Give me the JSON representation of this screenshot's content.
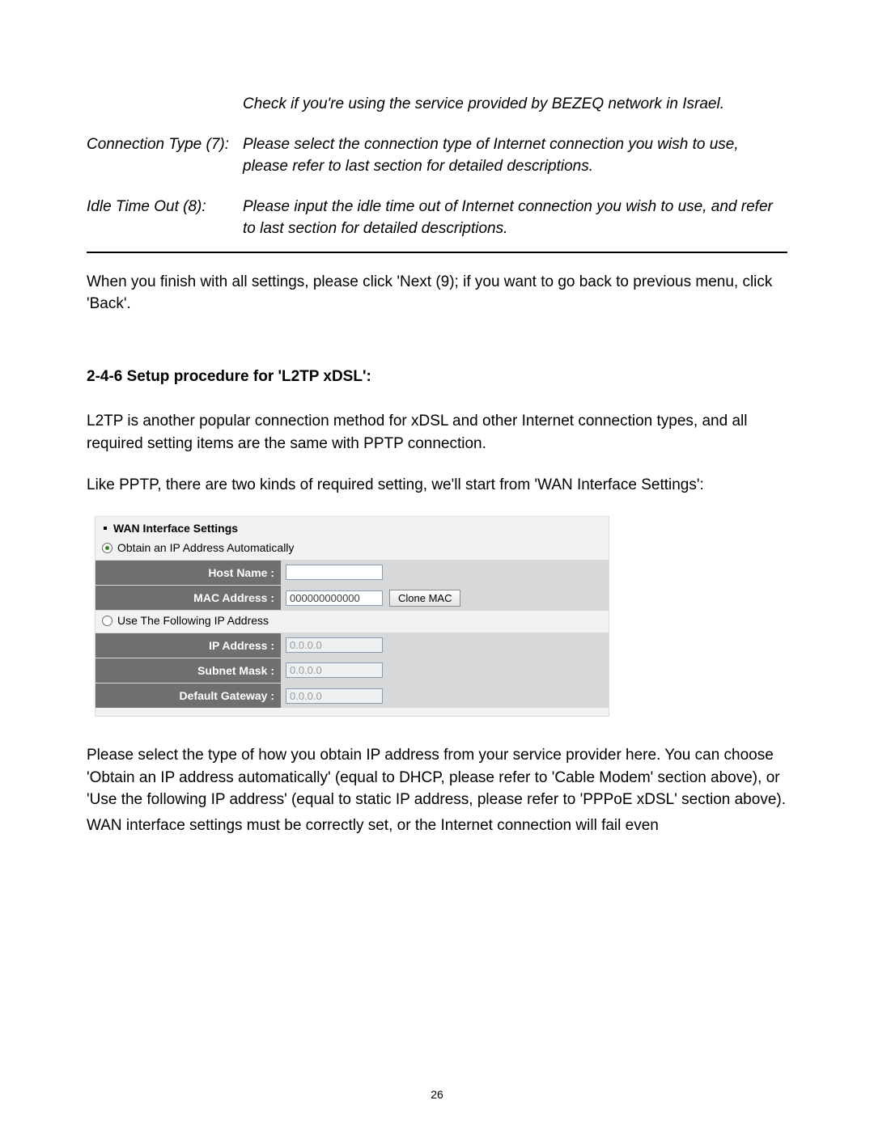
{
  "defs": {
    "bezeq_note": "Check if you're using the service provided by BEZEQ network in Israel.",
    "conn_type_term": "Connection Type (7):",
    "conn_type_desc": "Please select the connection type of Internet connection you wish to use, please refer to last section for detailed descriptions.",
    "idle_term": "Idle Time Out (8):",
    "idle_desc": "Please input the idle time out of Internet connection you wish to use, and refer to last section for detailed descriptions."
  },
  "para_after_defs": "When you finish with all settings, please click 'Next (9); if you want to go back to previous menu, click 'Back'.",
  "section_heading": "2-4-6 Setup procedure for 'L2TP xDSL':",
  "para_l2tp_1": "L2TP is another popular connection method for xDSL and other Internet connection types, and all required setting items are the same with PPTP connection.",
  "para_l2tp_2": "Like PPTP, there are two kinds of required setting, we'll start from 'WAN Interface Settings':",
  "panel": {
    "title": "WAN Interface Settings",
    "radio_auto": "Obtain an IP Address Automatically",
    "radio_static": "Use The Following IP Address",
    "rows": {
      "host_name": {
        "label": "Host Name :",
        "value": ""
      },
      "mac_address": {
        "label": "MAC Address :",
        "value": "000000000000"
      },
      "clone_mac_btn": "Clone MAC",
      "ip_address": {
        "label": "IP Address :",
        "value": "0.0.0.0"
      },
      "subnet_mask": {
        "label": "Subnet Mask :",
        "value": "0.0.0.0"
      },
      "default_gateway": {
        "label": "Default Gateway :",
        "value": "0.0.0.0"
      }
    }
  },
  "para_below_1": "Please select the type of how you obtain IP address from your service provider here. You can choose 'Obtain an IP address automatically' (equal to DHCP, please refer to 'Cable Modem' section above), or 'Use the following IP address' (equal to static IP address, please refer to 'PPPoE xDSL' section above).",
  "para_below_2": "WAN interface settings must be correctly set, or the Internet connection will fail even",
  "page_number": "26"
}
